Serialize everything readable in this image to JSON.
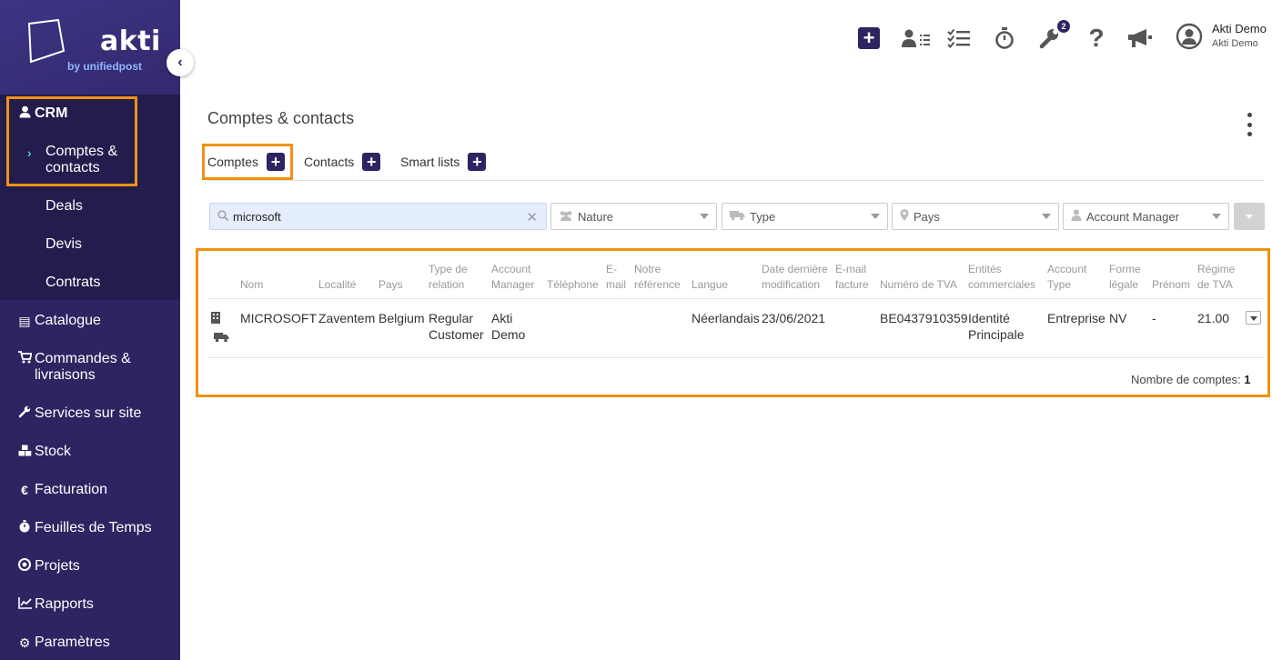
{
  "sidebar": {
    "logo_text": "akti",
    "logo_sub": "by unifiedpost",
    "crm": {
      "label": "CRM",
      "icon": "user-icon"
    },
    "crm_items": [
      {
        "label_line1": "Comptes &",
        "label_line2": "contacts",
        "active": true
      },
      {
        "label": "Deals"
      },
      {
        "label": "Devis"
      },
      {
        "label": "Contrats"
      }
    ],
    "items": [
      {
        "label": "Catalogue",
        "icon": "book-icon"
      },
      {
        "label_line1": "Commandes &",
        "label_line2": "livraisons",
        "icon": "cart-icon"
      },
      {
        "label": "Services sur site",
        "icon": "wrench-icon"
      },
      {
        "label": "Stock",
        "icon": "boxes-icon"
      },
      {
        "label": "Facturation",
        "icon": "euro-icon"
      },
      {
        "label": "Feuilles de Temps",
        "icon": "stopwatch-icon"
      },
      {
        "label": "Projets",
        "icon": "target-icon"
      },
      {
        "label": "Rapports",
        "icon": "chart-icon"
      },
      {
        "label": "Paramètres",
        "icon": "gear-icon"
      }
    ]
  },
  "topbar": {
    "badge_count": "2",
    "user_name": "Akti Demo",
    "user_company": "Akti Demo"
  },
  "page": {
    "title": "Comptes & contacts",
    "tabs": [
      {
        "label": "Comptes",
        "active": true
      },
      {
        "label": "Contacts"
      },
      {
        "label": "Smart lists"
      }
    ]
  },
  "filters": {
    "search_value": "microsoft",
    "nature": "Nature",
    "type": "Type",
    "pays": "Pays",
    "account_manager": "Account Manager"
  },
  "table": {
    "headers": [
      {
        "l1": "",
        "l2": "Nom"
      },
      {
        "l1": "",
        "l2": "Localité"
      },
      {
        "l1": "",
        "l2": "Pays"
      },
      {
        "l1": "Type de",
        "l2": "relation"
      },
      {
        "l1": "Account",
        "l2": "Manager"
      },
      {
        "l1": "",
        "l2": "Téléphone"
      },
      {
        "l1": "E-",
        "l2": "mail"
      },
      {
        "l1": "Notre",
        "l2": "référence"
      },
      {
        "l1": "",
        "l2": "Langue"
      },
      {
        "l1": "Date dernière",
        "l2": "modification"
      },
      {
        "l1": "E-mail",
        "l2": "facture"
      },
      {
        "l1": "",
        "l2": "Numéro de TVA"
      },
      {
        "l1": "Entités",
        "l2": "commerciales"
      },
      {
        "l1": "Account",
        "l2": "Type"
      },
      {
        "l1": "Forme",
        "l2": "légale"
      },
      {
        "l1": "",
        "l2": "Prénom"
      },
      {
        "l1": "Régime",
        "l2": "de TVA"
      }
    ],
    "rows": [
      {
        "nom": "MICROSOFT",
        "localite": "Zaventem",
        "pays": "Belgium",
        "type_relation_1": "Regular",
        "type_relation_2": "Customer",
        "account_manager_1": "Akti",
        "account_manager_2": "Demo",
        "langue": "Néerlandais",
        "date_modif": "23/06/2021",
        "tva": "BE0437910359",
        "entites_1": "Identité",
        "entites_2": "Principale",
        "account_type": "Entreprise",
        "forme_legale": "NV",
        "prenom": "-",
        "regime_tva": "21.00"
      }
    ],
    "count_label": "Nombre de comptes:",
    "count_value": "1"
  }
}
